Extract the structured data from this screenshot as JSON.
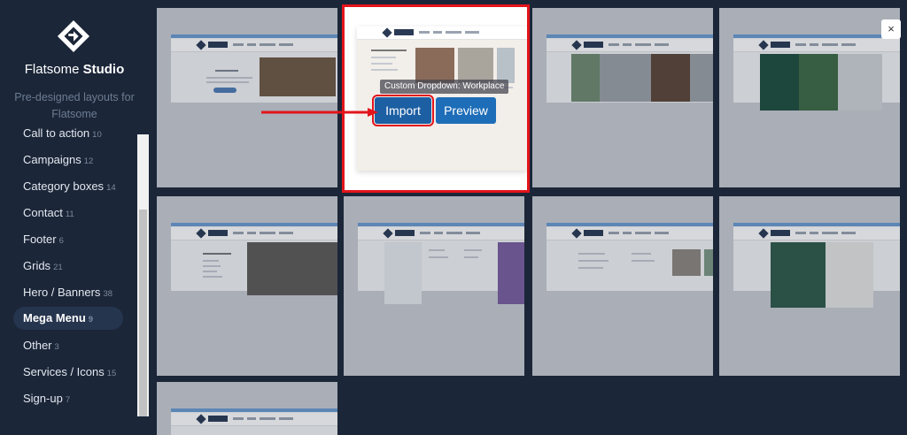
{
  "brand": {
    "name_regular": "Flatsome",
    "name_bold": "Studio",
    "tagline": "Pre-designed layouts for Flatsome"
  },
  "categories": [
    {
      "label": "Call to action",
      "count": "10"
    },
    {
      "label": "Campaigns",
      "count": "12"
    },
    {
      "label": "Category boxes",
      "count": "14"
    },
    {
      "label": "Contact",
      "count": "11"
    },
    {
      "label": "Footer",
      "count": "6"
    },
    {
      "label": "Grids",
      "count": "21"
    },
    {
      "label": "Hero / Banners",
      "count": "38"
    },
    {
      "label": "Mega Menu",
      "count": "9",
      "active": true
    },
    {
      "label": "Other",
      "count": "3"
    },
    {
      "label": "Services / Icons",
      "count": "15"
    },
    {
      "label": "Sign-up",
      "count": "7"
    }
  ],
  "selected_card": {
    "tooltip": "Custom Dropdown: Workplace",
    "import_label": "Import",
    "preview_label": "Preview"
  },
  "close_label": "×",
  "colors": {
    "sidebar_bg": "#1b2638",
    "active_item_bg": "#26354e",
    "highlight": "#e3141b",
    "button_blue": "#1d5fa3"
  }
}
